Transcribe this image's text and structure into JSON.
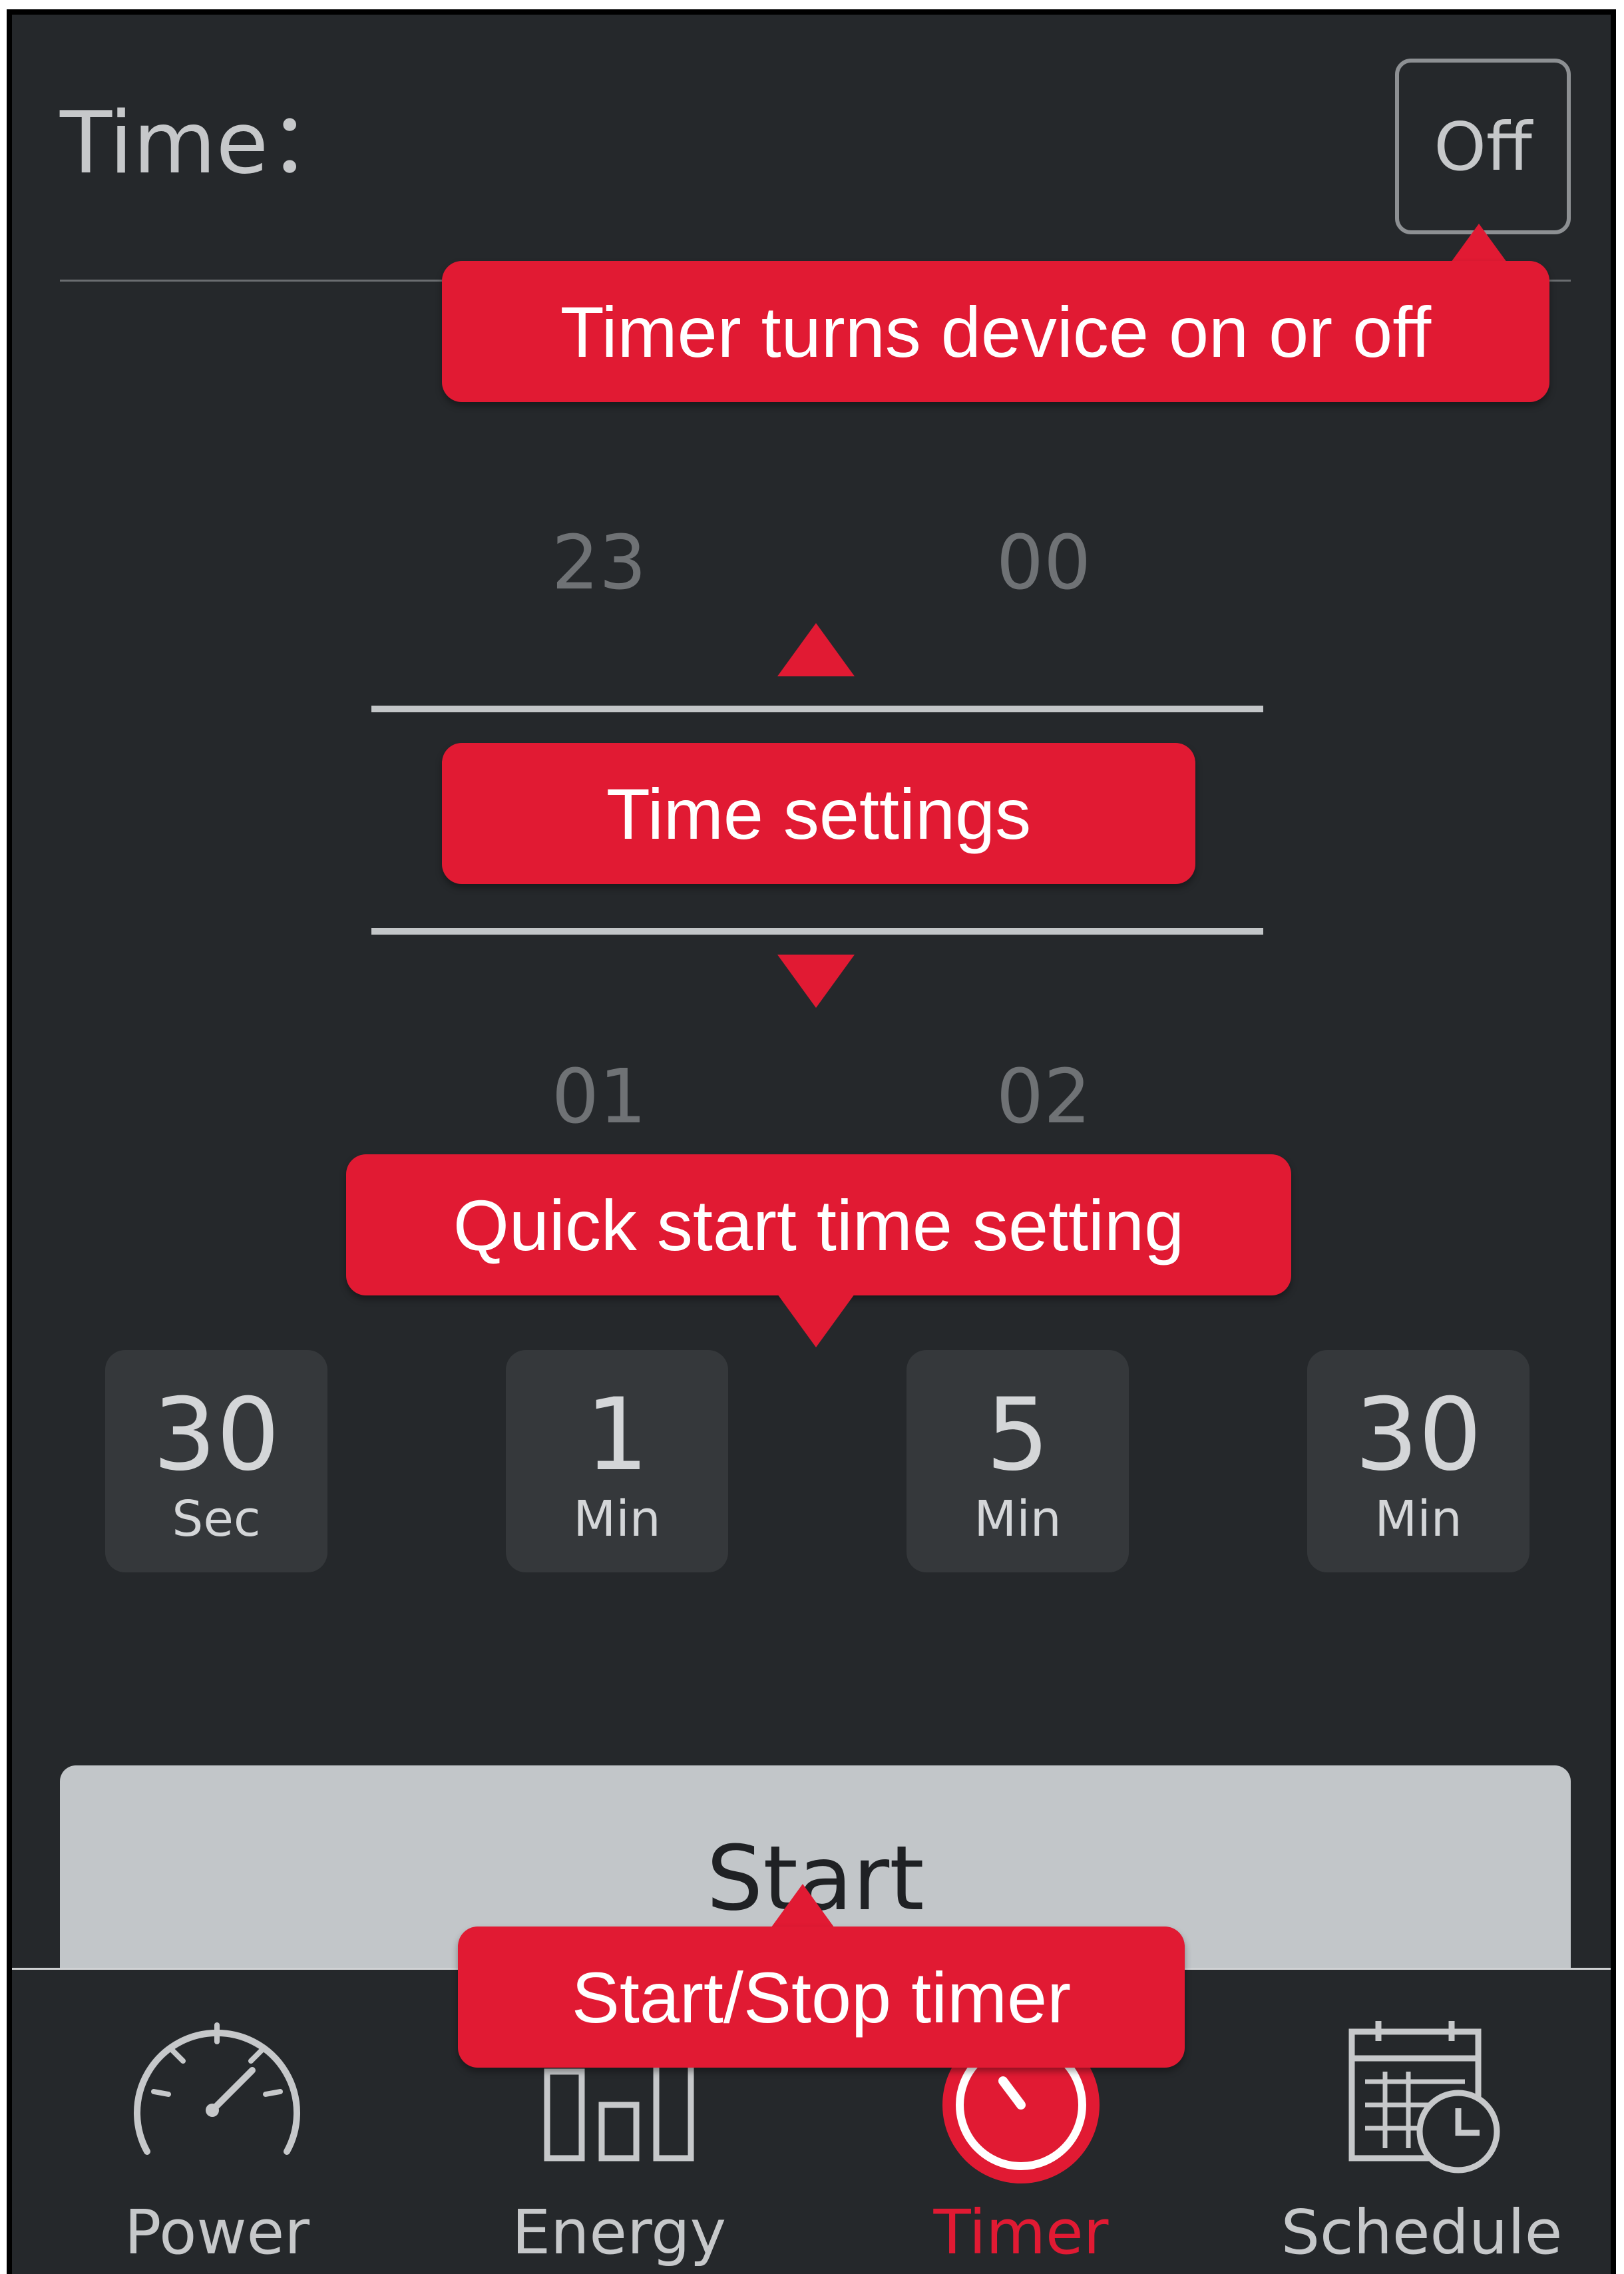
{
  "header": {
    "time_label": "Time：",
    "off_label": "Off"
  },
  "picker": {
    "above": [
      "23",
      "00"
    ],
    "below": [
      "01",
      "02"
    ]
  },
  "quick_start": [
    {
      "value": "30",
      "unit": "Sec"
    },
    {
      "value": "1",
      "unit": "Min"
    },
    {
      "value": "5",
      "unit": "Min"
    },
    {
      "value": "30",
      "unit": "Min"
    }
  ],
  "start_label": "Start",
  "nav": [
    {
      "label": "Power",
      "icon": "speedometer-icon",
      "active": false
    },
    {
      "label": "Energy",
      "icon": "bar-chart-icon",
      "active": false
    },
    {
      "label": "Timer",
      "icon": "timer-icon",
      "active": true
    },
    {
      "label": "Schedule",
      "icon": "calendar-clock-icon",
      "active": false
    }
  ],
  "callouts": {
    "timer_toggle": "Timer turns device on or off",
    "time_settings": "Time settings",
    "quick_start": "Quick start time setting",
    "start_stop": "Start/Stop timer"
  },
  "colors": {
    "background": "#25282b",
    "accent": "#e11a33",
    "button": "#c2c6c9",
    "tile": "#35383b"
  }
}
